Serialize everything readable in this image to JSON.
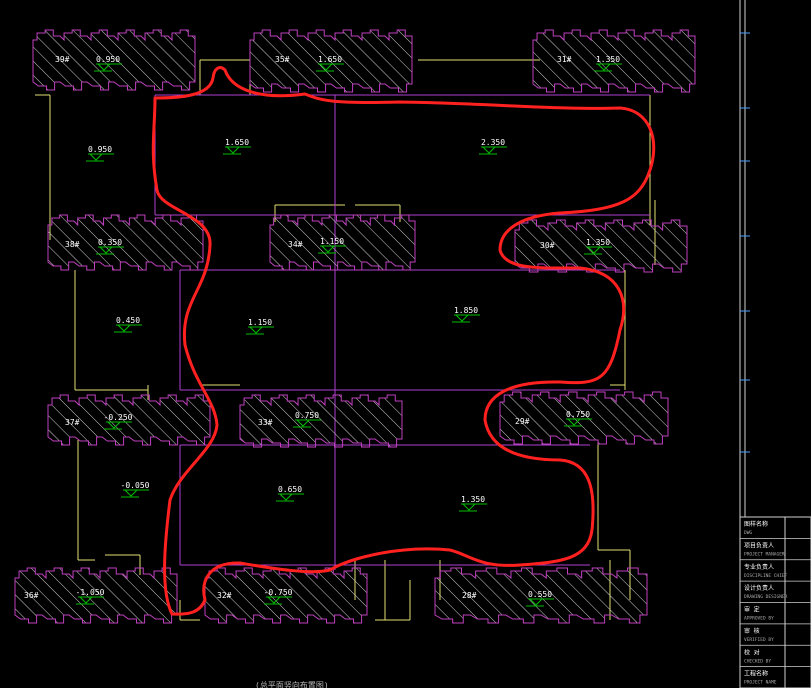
{
  "colors": {
    "background": "#000000",
    "building_outline": "#c040c0",
    "hatch": "#cfcfcf",
    "site_line": "#e0e070",
    "grid_line": "#b040d0",
    "elevation_marker": "#00c000",
    "markup": "#ff2020",
    "label_text": "#ffffff"
  },
  "buildings": [
    {
      "id": "b39",
      "label": "39#",
      "elevation": "0.950"
    },
    {
      "id": "b35",
      "label": "35#",
      "elevation": "1.650"
    },
    {
      "id": "b31",
      "label": "31#",
      "elevation": "1.350"
    },
    {
      "id": "b38",
      "label": "38#",
      "elevation": "0.350"
    },
    {
      "id": "b34",
      "label": "34#",
      "elevation": "1.150"
    },
    {
      "id": "b30",
      "label": "30#",
      "elevation": "1.350"
    },
    {
      "id": "b37",
      "label": "37#",
      "elevation": "-0.250"
    },
    {
      "id": "b33",
      "label": "33#",
      "elevation": "0.750"
    },
    {
      "id": "b29",
      "label": "29#",
      "elevation": "0.750"
    },
    {
      "id": "b36",
      "label": "36#",
      "elevation": "-1.050"
    },
    {
      "id": "b32",
      "label": "32#",
      "elevation": "-0.750"
    },
    {
      "id": "b28",
      "label": "28#",
      "elevation": "0.550"
    }
  ],
  "ground_elevations": [
    {
      "id": "g1",
      "value": "0.950"
    },
    {
      "id": "g2",
      "value": "1.650"
    },
    {
      "id": "g3",
      "value": "2.350"
    },
    {
      "id": "g4",
      "value": "0.450"
    },
    {
      "id": "g5",
      "value": "1.150"
    },
    {
      "id": "g6",
      "value": "1.850"
    },
    {
      "id": "g7",
      "value": "-0.050"
    },
    {
      "id": "g8",
      "value": "0.650"
    },
    {
      "id": "g9",
      "value": "1.350"
    }
  ],
  "title_block": {
    "rows": [
      {
        "cn": "图样名称",
        "en": "DWG"
      },
      {
        "cn": "项目负责人",
        "en": "PROJECT MANAGER"
      },
      {
        "cn": "专业负责人",
        "en": "DISCIPLINE CHIEF"
      },
      {
        "cn": "设计负责人",
        "en": "DRAWING DESIGNER"
      },
      {
        "cn": "审  定",
        "en": "APPROVED BY"
      },
      {
        "cn": "审  核",
        "en": "VERIFIED BY"
      },
      {
        "cn": "校  对",
        "en": "CHECKED BY"
      },
      {
        "cn": "工程名称",
        "en": "PROJECT NAME"
      }
    ]
  },
  "footer_caption": "(总平面竖向布置图)"
}
